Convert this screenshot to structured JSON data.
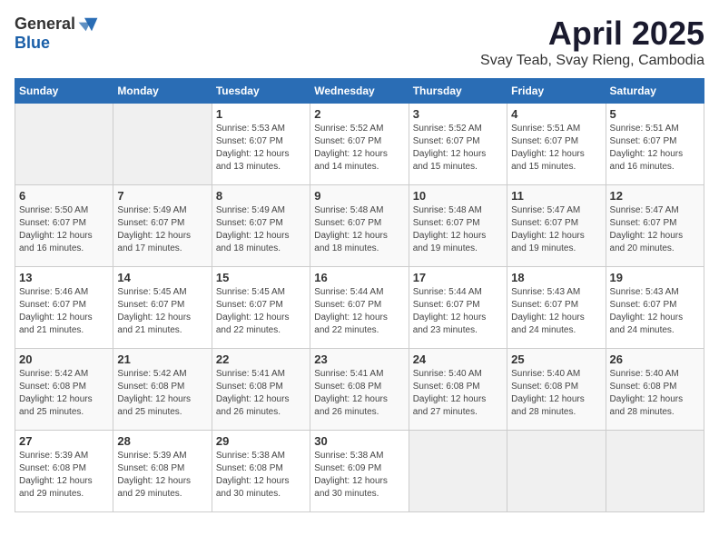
{
  "logo": {
    "general": "General",
    "blue": "Blue"
  },
  "title": "April 2025",
  "subtitle": "Svay Teab, Svay Rieng, Cambodia",
  "days_of_week": [
    "Sunday",
    "Monday",
    "Tuesday",
    "Wednesday",
    "Thursday",
    "Friday",
    "Saturday"
  ],
  "weeks": [
    [
      {
        "day": "",
        "info": ""
      },
      {
        "day": "",
        "info": ""
      },
      {
        "day": "1",
        "info": "Sunrise: 5:53 AM\nSunset: 6:07 PM\nDaylight: 12 hours and 13 minutes."
      },
      {
        "day": "2",
        "info": "Sunrise: 5:52 AM\nSunset: 6:07 PM\nDaylight: 12 hours and 14 minutes."
      },
      {
        "day": "3",
        "info": "Sunrise: 5:52 AM\nSunset: 6:07 PM\nDaylight: 12 hours and 15 minutes."
      },
      {
        "day": "4",
        "info": "Sunrise: 5:51 AM\nSunset: 6:07 PM\nDaylight: 12 hours and 15 minutes."
      },
      {
        "day": "5",
        "info": "Sunrise: 5:51 AM\nSunset: 6:07 PM\nDaylight: 12 hours and 16 minutes."
      }
    ],
    [
      {
        "day": "6",
        "info": "Sunrise: 5:50 AM\nSunset: 6:07 PM\nDaylight: 12 hours and 16 minutes."
      },
      {
        "day": "7",
        "info": "Sunrise: 5:49 AM\nSunset: 6:07 PM\nDaylight: 12 hours and 17 minutes."
      },
      {
        "day": "8",
        "info": "Sunrise: 5:49 AM\nSunset: 6:07 PM\nDaylight: 12 hours and 18 minutes."
      },
      {
        "day": "9",
        "info": "Sunrise: 5:48 AM\nSunset: 6:07 PM\nDaylight: 12 hours and 18 minutes."
      },
      {
        "day": "10",
        "info": "Sunrise: 5:48 AM\nSunset: 6:07 PM\nDaylight: 12 hours and 19 minutes."
      },
      {
        "day": "11",
        "info": "Sunrise: 5:47 AM\nSunset: 6:07 PM\nDaylight: 12 hours and 19 minutes."
      },
      {
        "day": "12",
        "info": "Sunrise: 5:47 AM\nSunset: 6:07 PM\nDaylight: 12 hours and 20 minutes."
      }
    ],
    [
      {
        "day": "13",
        "info": "Sunrise: 5:46 AM\nSunset: 6:07 PM\nDaylight: 12 hours and 21 minutes."
      },
      {
        "day": "14",
        "info": "Sunrise: 5:45 AM\nSunset: 6:07 PM\nDaylight: 12 hours and 21 minutes."
      },
      {
        "day": "15",
        "info": "Sunrise: 5:45 AM\nSunset: 6:07 PM\nDaylight: 12 hours and 22 minutes."
      },
      {
        "day": "16",
        "info": "Sunrise: 5:44 AM\nSunset: 6:07 PM\nDaylight: 12 hours and 22 minutes."
      },
      {
        "day": "17",
        "info": "Sunrise: 5:44 AM\nSunset: 6:07 PM\nDaylight: 12 hours and 23 minutes."
      },
      {
        "day": "18",
        "info": "Sunrise: 5:43 AM\nSunset: 6:07 PM\nDaylight: 12 hours and 24 minutes."
      },
      {
        "day": "19",
        "info": "Sunrise: 5:43 AM\nSunset: 6:07 PM\nDaylight: 12 hours and 24 minutes."
      }
    ],
    [
      {
        "day": "20",
        "info": "Sunrise: 5:42 AM\nSunset: 6:08 PM\nDaylight: 12 hours and 25 minutes."
      },
      {
        "day": "21",
        "info": "Sunrise: 5:42 AM\nSunset: 6:08 PM\nDaylight: 12 hours and 25 minutes."
      },
      {
        "day": "22",
        "info": "Sunrise: 5:41 AM\nSunset: 6:08 PM\nDaylight: 12 hours and 26 minutes."
      },
      {
        "day": "23",
        "info": "Sunrise: 5:41 AM\nSunset: 6:08 PM\nDaylight: 12 hours and 26 minutes."
      },
      {
        "day": "24",
        "info": "Sunrise: 5:40 AM\nSunset: 6:08 PM\nDaylight: 12 hours and 27 minutes."
      },
      {
        "day": "25",
        "info": "Sunrise: 5:40 AM\nSunset: 6:08 PM\nDaylight: 12 hours and 28 minutes."
      },
      {
        "day": "26",
        "info": "Sunrise: 5:40 AM\nSunset: 6:08 PM\nDaylight: 12 hours and 28 minutes."
      }
    ],
    [
      {
        "day": "27",
        "info": "Sunrise: 5:39 AM\nSunset: 6:08 PM\nDaylight: 12 hours and 29 minutes."
      },
      {
        "day": "28",
        "info": "Sunrise: 5:39 AM\nSunset: 6:08 PM\nDaylight: 12 hours and 29 minutes."
      },
      {
        "day": "29",
        "info": "Sunrise: 5:38 AM\nSunset: 6:08 PM\nDaylight: 12 hours and 30 minutes."
      },
      {
        "day": "30",
        "info": "Sunrise: 5:38 AM\nSunset: 6:09 PM\nDaylight: 12 hours and 30 minutes."
      },
      {
        "day": "",
        "info": ""
      },
      {
        "day": "",
        "info": ""
      },
      {
        "day": "",
        "info": ""
      }
    ]
  ]
}
